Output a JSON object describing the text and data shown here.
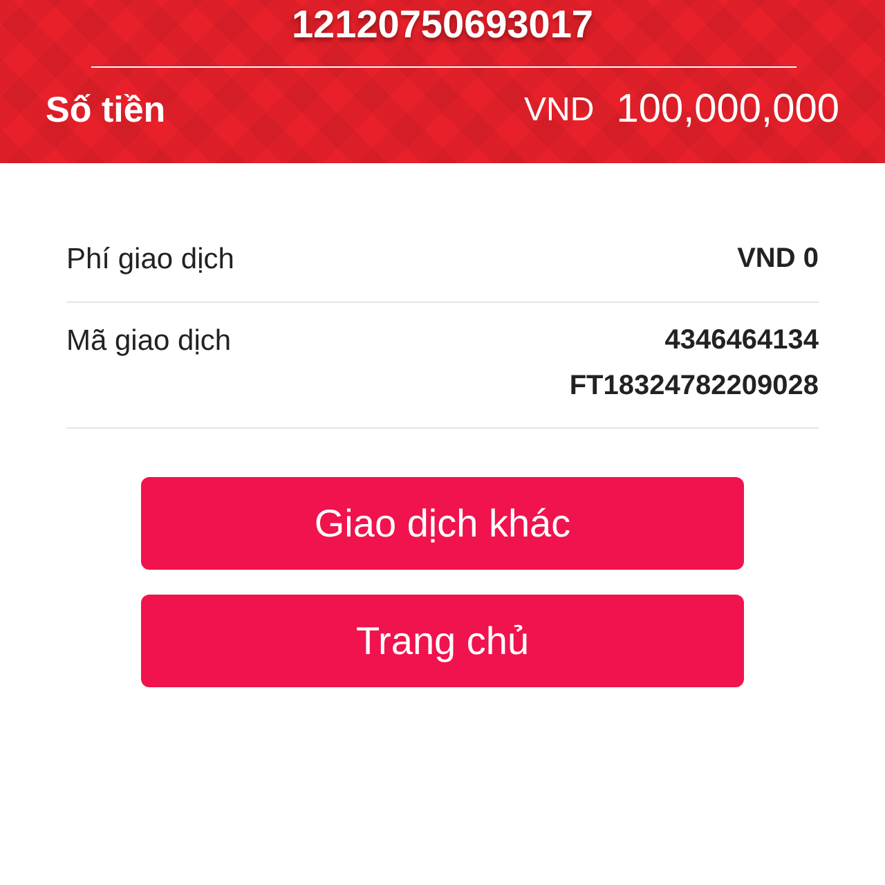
{
  "header": {
    "account_number": "12120750693017",
    "amount_label": "Số tiền",
    "currency": "VND",
    "amount": "100,000,000"
  },
  "details": [
    {
      "label": "Phí giao dịch",
      "values": [
        "VND 0"
      ]
    },
    {
      "label": "Mã giao dịch",
      "values": [
        "4346464134",
        "FT18324782209028"
      ]
    }
  ],
  "buttons": [
    "Giao dịch khác",
    "Trang chủ"
  ]
}
